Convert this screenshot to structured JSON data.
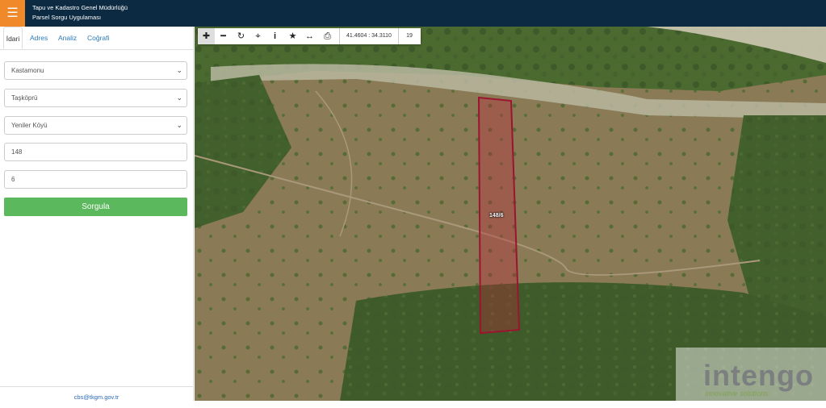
{
  "header": {
    "menu_icon": "hamburger-icon",
    "title_line1": "Tapu ve Kadastro Genel Müdürlüğü",
    "title_line2": "Parsel Sorgu Uygulaması",
    "bar_color": "#0c2a42",
    "menu_color": "#f0892a"
  },
  "sidebar": {
    "tabs": [
      {
        "label": "İdari",
        "active": true
      },
      {
        "label": "Adres",
        "active": false
      },
      {
        "label": "Analiz",
        "active": false
      },
      {
        "label": "Coğrafi",
        "active": false
      }
    ],
    "il": "Kastamonu",
    "ilce": "Taşköprü",
    "mahalle": "Yeniler Köyü",
    "ada": "148",
    "parsel": "6",
    "submit_label": "Sorgula",
    "submit_color": "#5cb85c",
    "footer_email": "cbs@tkgm.gov.tr"
  },
  "map": {
    "toolbar_icons": [
      "zoom-in-icon",
      "zoom-out-icon",
      "refresh-icon",
      "locate-icon",
      "info-icon",
      "star-icon",
      "measure-icon",
      "print-icon"
    ],
    "coordinates": "41.4604 : 34.3110",
    "zoom_level": "19",
    "parcel_label": "148/6",
    "parcel_color": "#b01c3c",
    "watermark_text": "intengo",
    "watermark_sub": "innovative solutions"
  }
}
